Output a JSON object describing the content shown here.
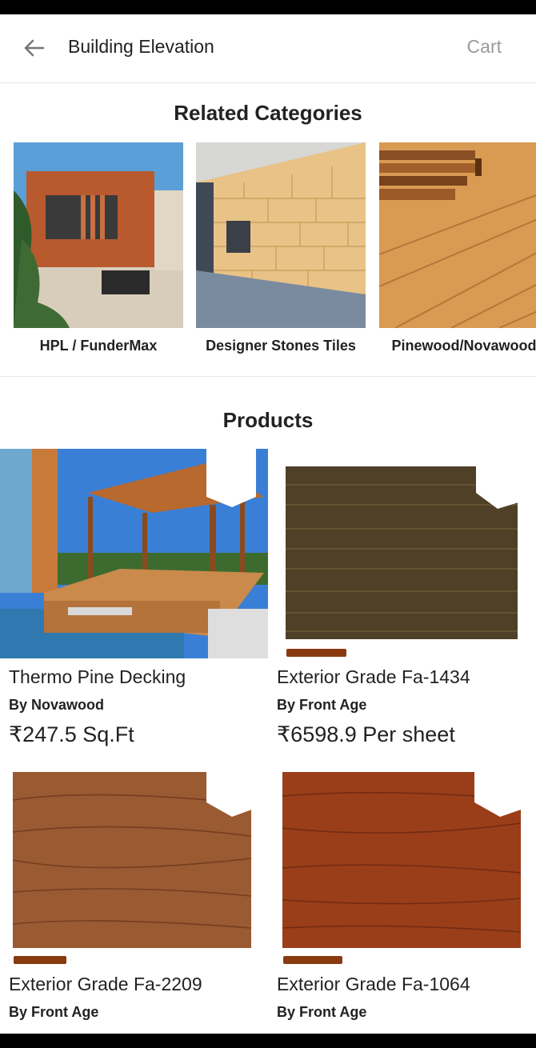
{
  "app_bar": {
    "title": "Building Elevation",
    "cart_label": "Cart"
  },
  "related_categories": {
    "heading": "Related Categories",
    "items": [
      {
        "label": "HPL / FunderMax"
      },
      {
        "label": "Designer Stones Tiles"
      },
      {
        "label": "Pinewood/Novawood"
      }
    ]
  },
  "products": {
    "heading": "Products",
    "items": [
      {
        "name": "Thermo Pine Decking",
        "brand": "By Novawood",
        "price": "₹247.5 Sq.Ft"
      },
      {
        "name": "Exterior Grade Fa-1434",
        "brand": "By Front Age",
        "price": "₹6598.9 Per sheet"
      },
      {
        "name": "Exterior Grade Fa-2209",
        "brand": "By Front Age"
      },
      {
        "name": "Exterior Grade Fa-1064",
        "brand": "By Front Age"
      }
    ]
  },
  "colors": {
    "divider": "#e6e6e6",
    "cart_text": "#9a9a9a",
    "text": "#222222"
  }
}
